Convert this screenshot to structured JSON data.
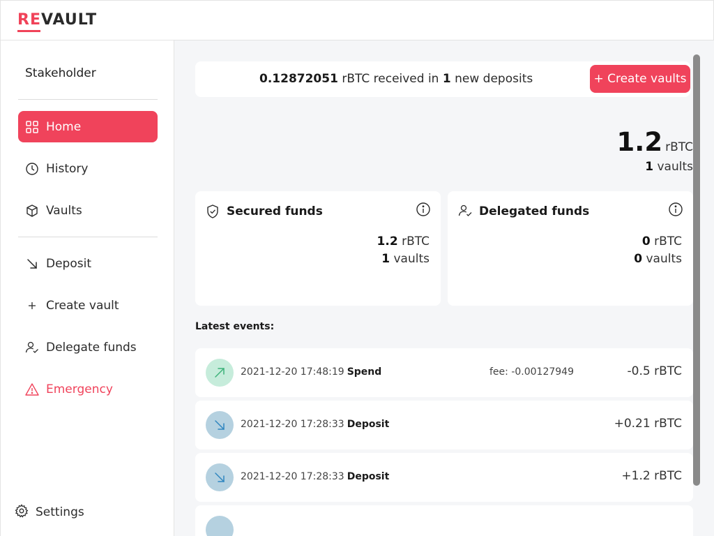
{
  "header": {
    "logo_prefix": "RE",
    "logo_suffix": "VAULT"
  },
  "sidebar": {
    "role": "Stakeholder",
    "items": [
      {
        "label": "Home",
        "icon": "grid-icon"
      },
      {
        "label": "History",
        "icon": "clock-icon"
      },
      {
        "label": "Vaults",
        "icon": "cube-icon"
      },
      {
        "label": "Deposit",
        "icon": "arrow-down-right-icon"
      },
      {
        "label": "Create vault",
        "icon": "plus-icon"
      },
      {
        "label": "Delegate funds",
        "icon": "person-check-icon"
      },
      {
        "label": "Emergency",
        "icon": "warning-icon"
      }
    ],
    "settings_label": "Settings"
  },
  "notice": {
    "amount": "0.12872051",
    "text_mid": "rBTC received in",
    "count": "1",
    "text_end": "new deposits",
    "button_label": "+ Create vaults"
  },
  "summary": {
    "total": "1.2",
    "unit": "rBTC",
    "vaults_count": "1",
    "vaults_label": "vaults"
  },
  "cards": {
    "secured": {
      "title": "Secured funds",
      "amount": "1.2",
      "unit": "rBTC",
      "vaults": "1",
      "vaults_label": "vaults"
    },
    "delegated": {
      "title": "Delegated funds",
      "amount": "0",
      "unit": "rBTC",
      "vaults": "0",
      "vaults_label": "vaults"
    }
  },
  "latest_events_label": "Latest events:",
  "events": [
    {
      "date": "2021-12-20 17:48:19",
      "kind": "Spend",
      "fee": "fee: -0.00127949",
      "amount": "-0.5 rBTC"
    },
    {
      "date": "2021-12-20 17:28:33",
      "kind": "Deposit",
      "fee": "",
      "amount": "+0.21 rBTC"
    },
    {
      "date": "2021-12-20 17:28:33",
      "kind": "Deposit",
      "fee": "",
      "amount": "+1.2 rBTC"
    }
  ],
  "colors": {
    "accent": "#f0435b",
    "spend_bg": "#c6ecdb",
    "spend_arrow": "#3db27a",
    "deposit_bg": "#b5d1e0",
    "deposit_arrow": "#2f86bf",
    "main_bg": "#f5f6f8"
  }
}
